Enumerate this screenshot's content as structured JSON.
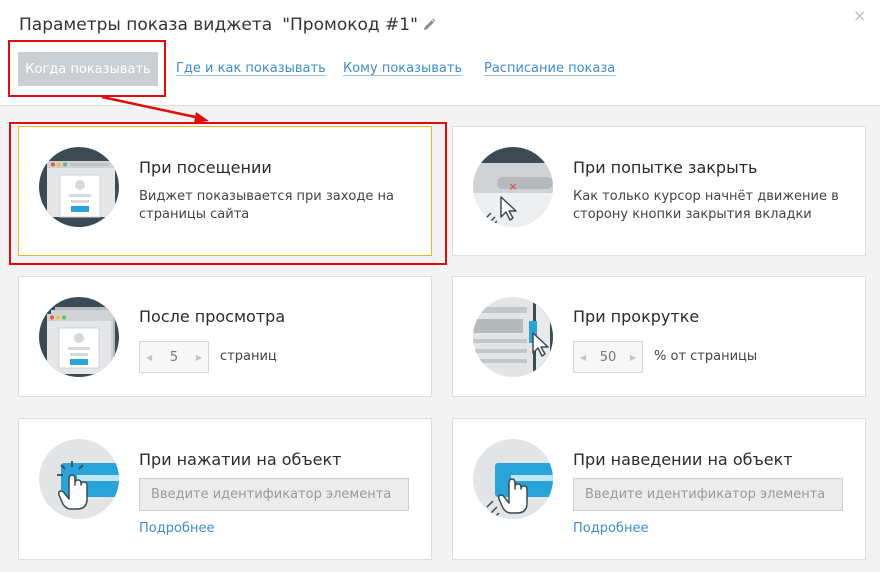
{
  "header": {
    "title": "Параметры показа виджета",
    "widget_name": "\"Промокод #1\"",
    "close": "×",
    "tabs": [
      {
        "label": "Когда показывать",
        "active": true
      },
      {
        "label": "Где и как показывать",
        "active": false
      },
      {
        "label": "Кому показывать",
        "active": false
      },
      {
        "label": "Расписание показа",
        "active": false
      }
    ]
  },
  "cards": {
    "visit": {
      "title": "При посещении",
      "description": "Виджет показывается при заходе на страницы сайта",
      "selected": true
    },
    "close_attempt": {
      "title": "При попытке закрыть",
      "description": "Как только курсор начнёт движение в сторону кнопки закрытия вкладки"
    },
    "after_views": {
      "title": "После просмотра",
      "value": "5",
      "unit": "страниц"
    },
    "scroll": {
      "title": "При прокрутке",
      "value": "50",
      "unit": "% от страницы"
    },
    "click": {
      "title": "При нажатии на объект",
      "placeholder": "Введите идентификатор элемента",
      "more": "Подробнее"
    },
    "hover": {
      "title": "При наведении на объект",
      "placeholder": "Введите идентификатор элемента",
      "more": "Подробнее"
    }
  },
  "colors": {
    "link": "#3d8ed0",
    "annotation_red": "#e00c0c",
    "selected_border": "#e9b52c",
    "tab_active_bg": "#c9cfd2",
    "icon_dark": "#3c4a54",
    "icon_blue": "#2aa4d8"
  }
}
